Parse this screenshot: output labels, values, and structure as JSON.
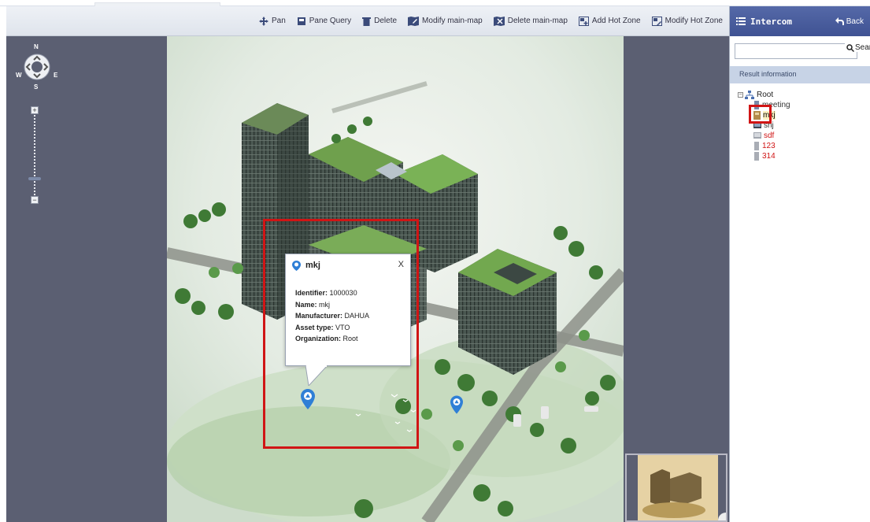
{
  "toolbar": {
    "items": [
      {
        "label": "Pan",
        "icon": "pan-icon"
      },
      {
        "label": "Pane Query",
        "icon": "pane-query-icon"
      },
      {
        "label": "Delete",
        "icon": "trash-icon"
      },
      {
        "label": "Modify main-map",
        "icon": "map-edit-icon"
      },
      {
        "label": "Delete main-map",
        "icon": "map-delete-icon"
      },
      {
        "label": "Add Hot Zone",
        "icon": "hotzone-add-icon"
      },
      {
        "label": "Modify Hot Zone",
        "icon": "hotzone-edit-icon"
      }
    ]
  },
  "compass": {
    "n": "N",
    "s": "S",
    "w": "W",
    "e": "E"
  },
  "popup": {
    "title": "mkj",
    "close": "X",
    "fields": [
      {
        "label": "Identifier:",
        "value": "1000030"
      },
      {
        "label": "Name:",
        "value": "mkj"
      },
      {
        "label": "Manufacturer:",
        "value": "DAHUA"
      },
      {
        "label": "Asset type:",
        "value": "VTO"
      },
      {
        "label": "Organization:",
        "value": "Root"
      }
    ]
  },
  "panel": {
    "title": "Intercom",
    "back": "Back",
    "search_button": "Search",
    "search_placeholder": "",
    "result_label": "Result information",
    "tree": {
      "root": "Root",
      "items": [
        {
          "label": "meeting",
          "color": "#333333"
        },
        {
          "label": "mkj",
          "color": "#000000"
        },
        {
          "label": "snj",
          "color": "#333333"
        },
        {
          "label": "sdf",
          "color": "#d01515"
        },
        {
          "label": "123",
          "color": "#d01515"
        },
        {
          "label": "314",
          "color": "#d01515"
        }
      ]
    }
  },
  "colors": {
    "header_blue": "#4a5d9f",
    "highlight_red": "#d01515",
    "marker_blue": "#2f7fd6"
  }
}
